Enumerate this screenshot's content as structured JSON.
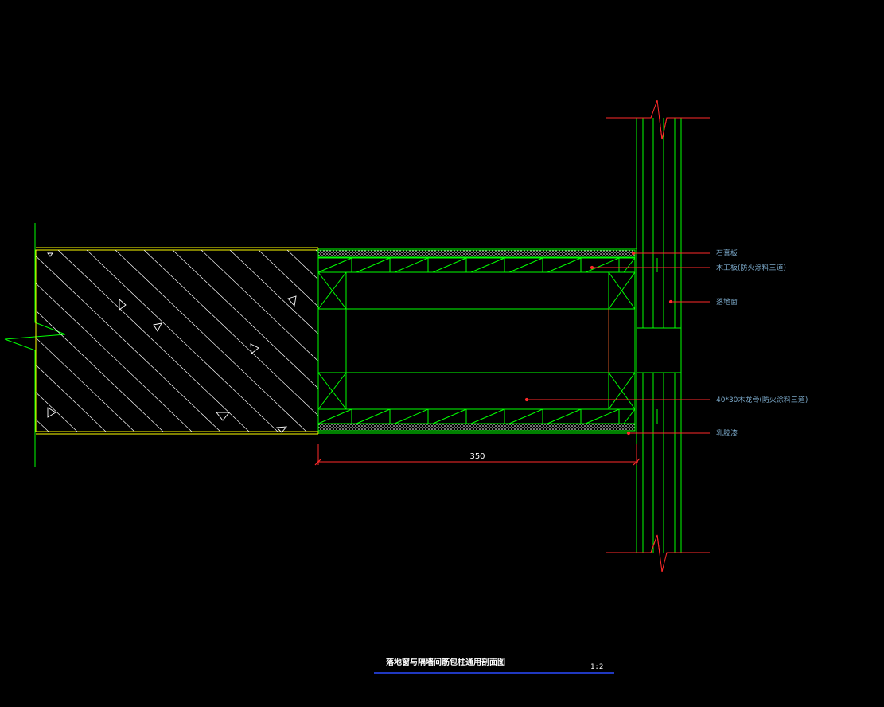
{
  "drawing": {
    "title": "落地窗与隔墙间筋包柱通用剖面图",
    "scale": "1:2",
    "dimension": "350",
    "colors": {
      "background": "#000000",
      "wood_lines": "#00ff00",
      "wall_outline": "#ffff00",
      "hatch": "#ffffff",
      "leader": "#ff2a2a",
      "callout_text": "#7aa7c7",
      "title_underline": "#2b4bff"
    }
  },
  "callouts": [
    {
      "id": "gypsum",
      "label": "石膏板"
    },
    {
      "id": "plywood",
      "label": "木工板(防火涂料三道)"
    },
    {
      "id": "window",
      "label": "落地窗"
    },
    {
      "id": "keel",
      "label": "40*30木龙骨(防火涂料三道)"
    },
    {
      "id": "paint",
      "label": "乳胶漆"
    }
  ]
}
